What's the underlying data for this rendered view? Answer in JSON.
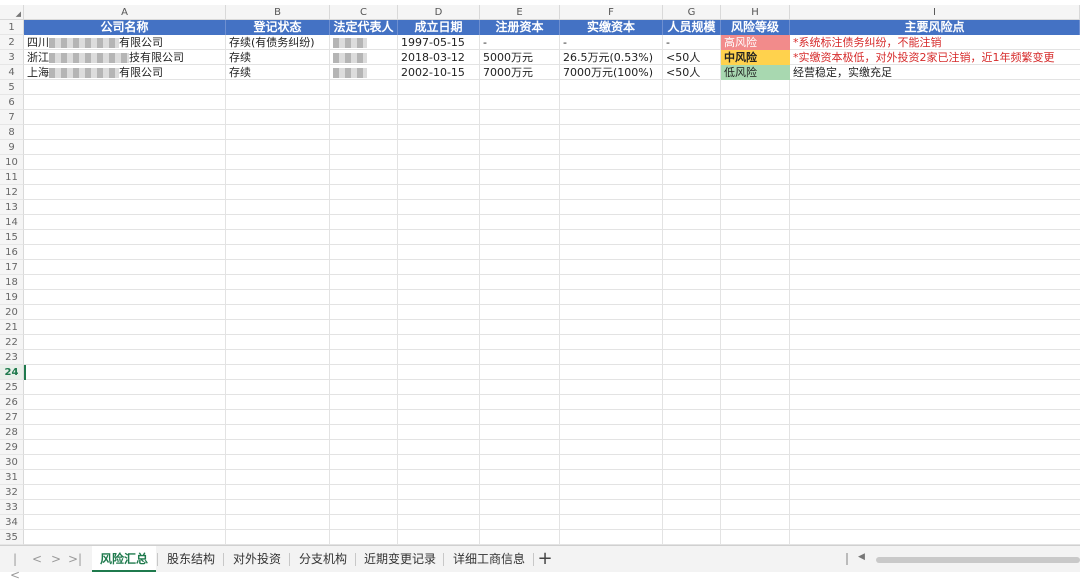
{
  "columns": [
    "A",
    "B",
    "C",
    "D",
    "E",
    "F",
    "G",
    "H",
    "I"
  ],
  "rows": [
    "1",
    "2",
    "3",
    "4",
    "5",
    "6",
    "7",
    "8",
    "9",
    "10",
    "11",
    "12",
    "13",
    "14",
    "15",
    "16",
    "17",
    "18",
    "19",
    "20",
    "21",
    "22",
    "23",
    "24",
    "25",
    "26",
    "27",
    "28",
    "29",
    "30",
    "31",
    "32",
    "33",
    "34",
    "35"
  ],
  "active_row": "24",
  "headers": [
    "公司名称",
    "登记状态",
    "法定代表人",
    "成立日期",
    "注册资本",
    "实缴资本",
    "人员规模",
    "风险等级",
    "主要风险点"
  ],
  "data_rows": [
    {
      "name_prefix": "四川",
      "name_suffix": "有限公司",
      "status": "存续(有债务纠纷)",
      "rep": "",
      "founded": "1997-05-15",
      "reg_capital": "-",
      "paid_capital": "-",
      "staff": "-",
      "risk": "高风险",
      "risk_color": "#f28b8b",
      "risk_point": "*系统标注债务纠纷，不能注销",
      "risk_point_red": true
    },
    {
      "name_prefix": "浙江",
      "name_suffix": "技有限公司",
      "status": "存续",
      "rep": "",
      "founded": "2018-03-12",
      "reg_capital": "5000万元",
      "paid_capital": "26.5万元(0.53%)",
      "staff": "<50人",
      "risk": "中风险",
      "risk_color": "#ffd24d",
      "risk_point": "*实缴资本极低，对外投资2家已注销，近1年频繁变更",
      "risk_point_red": true
    },
    {
      "name_prefix": "上海",
      "name_suffix": "有限公司",
      "status": "存续",
      "rep": "",
      "founded": "2002-10-15",
      "reg_capital": "7000万元",
      "paid_capital": "7000万元(100%)",
      "staff": "<50人",
      "risk": "低风险",
      "risk_color": "#a8d8b0",
      "risk_point": "经营稳定，实缴充足",
      "risk_point_red": false
    }
  ],
  "tabs": [
    "风险汇总",
    "股东结构",
    "对外投资",
    "分支机构",
    "近期变更记录",
    "详细工商信息"
  ],
  "active_tab": "风险汇总",
  "nav_icons": [
    "first-sheet-icon",
    "prev-sheet-icon",
    "next-sheet-icon",
    "last-sheet-icon"
  ],
  "add_tab_icon": "plus-icon"
}
